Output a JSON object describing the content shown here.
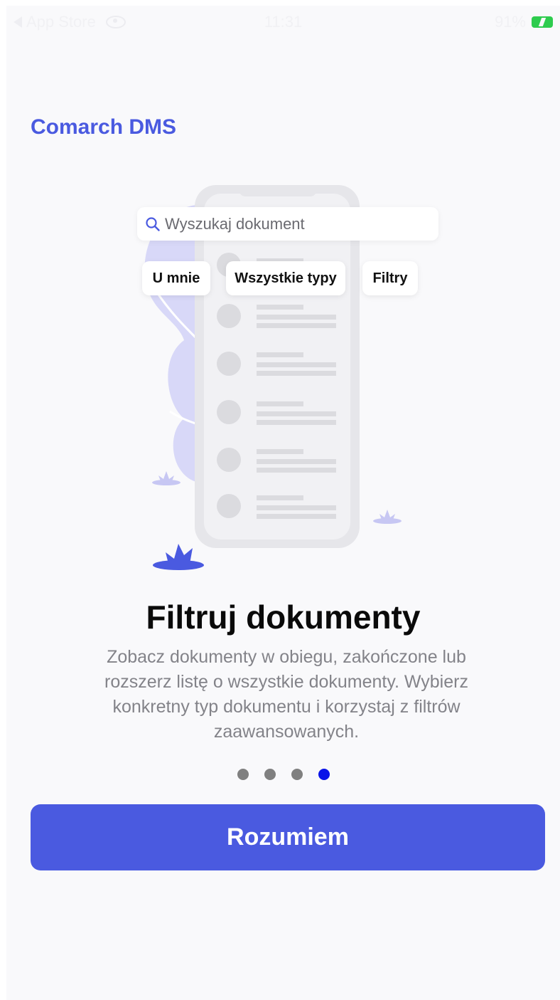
{
  "status_bar": {
    "back_label": "App Store",
    "time": "11:31",
    "battery": "91%"
  },
  "app": {
    "title": "Comarch DMS"
  },
  "illustration": {
    "search_placeholder": "Wyszukaj dokument",
    "chips": [
      "U mnie",
      "Wszystkie typy",
      "Filtry"
    ]
  },
  "onboarding": {
    "heading": "Filtruj dokumenty",
    "description": "Zobacz dokumenty w obiegu, zakończone lub rozszerz listę o wszystkie dokumenty. Wybierz konkretny typ dokumentu i korzystaj z filtrów zaawansowanych.",
    "page_count": 4,
    "active_page": 4
  },
  "actions": {
    "confirm_label": "Rozumiem"
  },
  "colors": {
    "accent": "#4a5ae0",
    "active_dot": "#0a14e8",
    "inactive_dot": "#808080",
    "illustration_purple": "#d3d3f6"
  }
}
